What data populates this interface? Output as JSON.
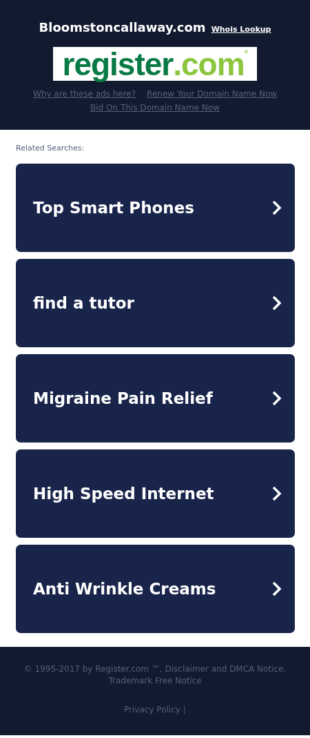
{
  "header": {
    "domain": "Bloomstoncallaway.com",
    "whois_link": "Whois Lookup",
    "logo": {
      "main": "register",
      "suffix": ".com",
      "mark": "®"
    },
    "links": [
      "Why are these ads here?",
      "Renew Your Domain Name Now",
      "Bid On This Domain Name Now"
    ]
  },
  "related": {
    "title": "Related Searches:",
    "items": [
      {
        "label": "Top Smart Phones"
      },
      {
        "label": "find a tutor"
      },
      {
        "label": "Migraine Pain Relief"
      },
      {
        "label": "High Speed Internet"
      },
      {
        "label": "Anti Wrinkle Creams"
      }
    ]
  },
  "footer": {
    "copyright": "© 1995-2017 by Register.com ™, Disclaimer and DMCA Notice. Trademark Free Notice",
    "privacy": "Privacy Policy",
    "separator": "|"
  }
}
